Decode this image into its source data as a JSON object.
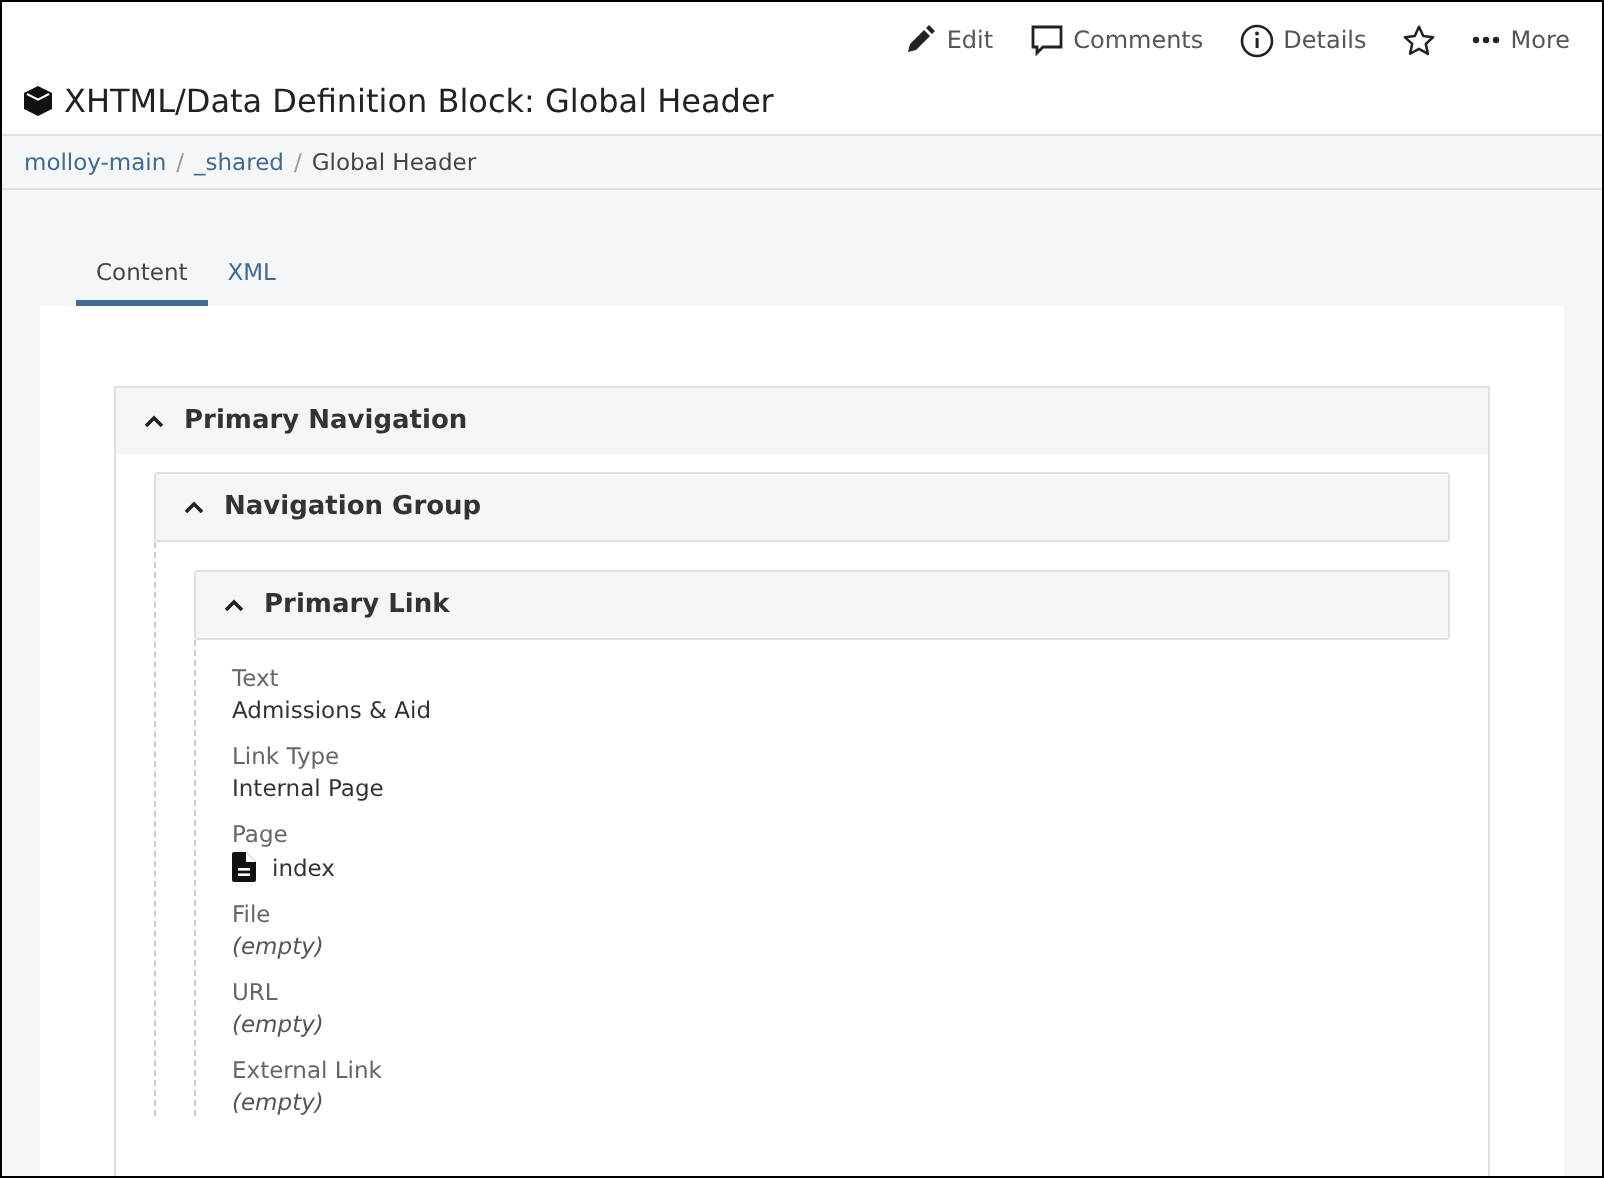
{
  "toolbar": [
    {
      "kind": "edit",
      "label": "Edit"
    },
    {
      "kind": "comments",
      "label": "Comments"
    },
    {
      "kind": "details",
      "label": "Details"
    },
    {
      "kind": "star"
    },
    {
      "kind": "more",
      "label": "More"
    }
  ],
  "title": "XHTML/Data Definition Block: Global Header",
  "breadcrumb": [
    {
      "label": "molloy-main"
    },
    {
      "separator": "/",
      "label": "_shared"
    },
    {
      "separator": "/",
      "label": "Global Header"
    }
  ],
  "tabs": [
    {
      "label": "Content",
      "selected": true
    },
    {
      "label": "XML",
      "selected": false
    }
  ],
  "section": {
    "title": "Primary Navigation",
    "expanded": true,
    "children": [
      {
        "title": "Navigation Group",
        "expanded": true,
        "children": [
          {
            "title": "Primary Link",
            "expanded": true,
            "fields": [
              {
                "label": "Text",
                "kind": "value",
                "value": "Admissions & Aid"
              },
              {
                "label": "Link Type",
                "kind": "value",
                "value": "Internal Page"
              },
              {
                "label": "Page",
                "kind": "page",
                "value": "index"
              },
              {
                "label": "File",
                "kind": "empty",
                "value": "(empty)"
              },
              {
                "label": "URL",
                "kind": "empty",
                "value": "(empty)"
              },
              {
                "label": "External Link",
                "kind": "empty",
                "value": "(empty)"
              }
            ]
          }
        ]
      }
    ]
  }
}
